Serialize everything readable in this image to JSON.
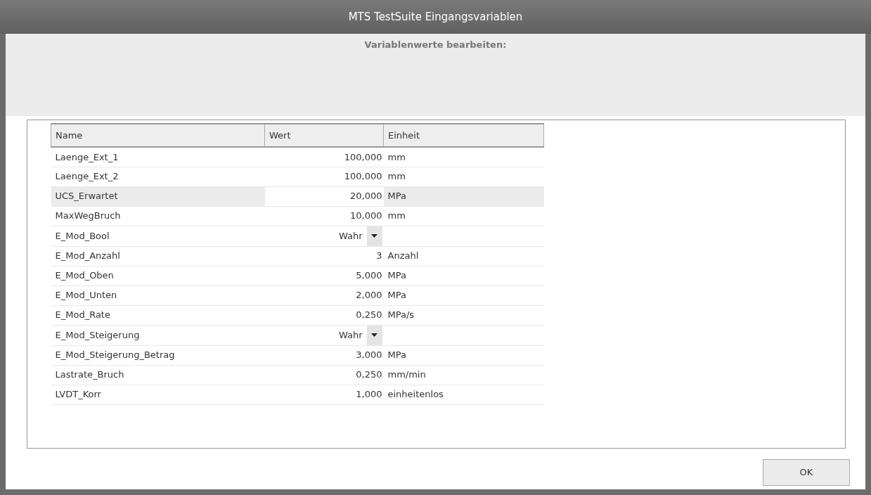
{
  "window": {
    "title": "MTS TestSuite Eingangsvariablen"
  },
  "header": {
    "text": "Variablenwerte bearbeiten:"
  },
  "table": {
    "columns": [
      "Name",
      "Wert",
      "Einheit"
    ],
    "rows": [
      {
        "name": "Laenge_Ext_1",
        "kind": "number",
        "value": "100,000",
        "unit": "mm",
        "selected": false
      },
      {
        "name": "Laenge_Ext_2",
        "kind": "number",
        "value": "100,000",
        "unit": "mm",
        "selected": false
      },
      {
        "name": "UCS_Erwartet",
        "kind": "number",
        "value": "20,000",
        "unit": "MPa",
        "selected": true
      },
      {
        "name": "MaxWegBruch",
        "kind": "number",
        "value": "10,000",
        "unit": "mm",
        "selected": false
      },
      {
        "name": "E_Mod_Bool",
        "kind": "dropdown",
        "value": "Wahr",
        "selected": false
      },
      {
        "name": "E_Mod_Anzahl",
        "kind": "number",
        "value": "3",
        "unit": "Anzahl",
        "selected": false
      },
      {
        "name": "E_Mod_Oben",
        "kind": "number",
        "value": "5,000",
        "unit": "MPa",
        "selected": false
      },
      {
        "name": "E_Mod_Unten",
        "kind": "number",
        "value": "2,000",
        "unit": "MPa",
        "selected": false
      },
      {
        "name": "E_Mod_Rate",
        "kind": "number",
        "value": "0,250",
        "unit": "MPa/s",
        "selected": false
      },
      {
        "name": "E_Mod_Steigerung",
        "kind": "dropdown",
        "value": "Wahr",
        "selected": false
      },
      {
        "name": "E_Mod_Steigerung_Betrag",
        "kind": "number",
        "value": "3,000",
        "unit": "MPa",
        "selected": false
      },
      {
        "name": "Lastrate_Bruch",
        "kind": "number",
        "value": "0,250",
        "unit": "mm/min",
        "selected": false
      },
      {
        "name": "LVDT_Korr",
        "kind": "number",
        "value": "1,000",
        "unit": "einheitenlos",
        "selected": false
      }
    ]
  },
  "buttons": [
    "OK"
  ]
}
